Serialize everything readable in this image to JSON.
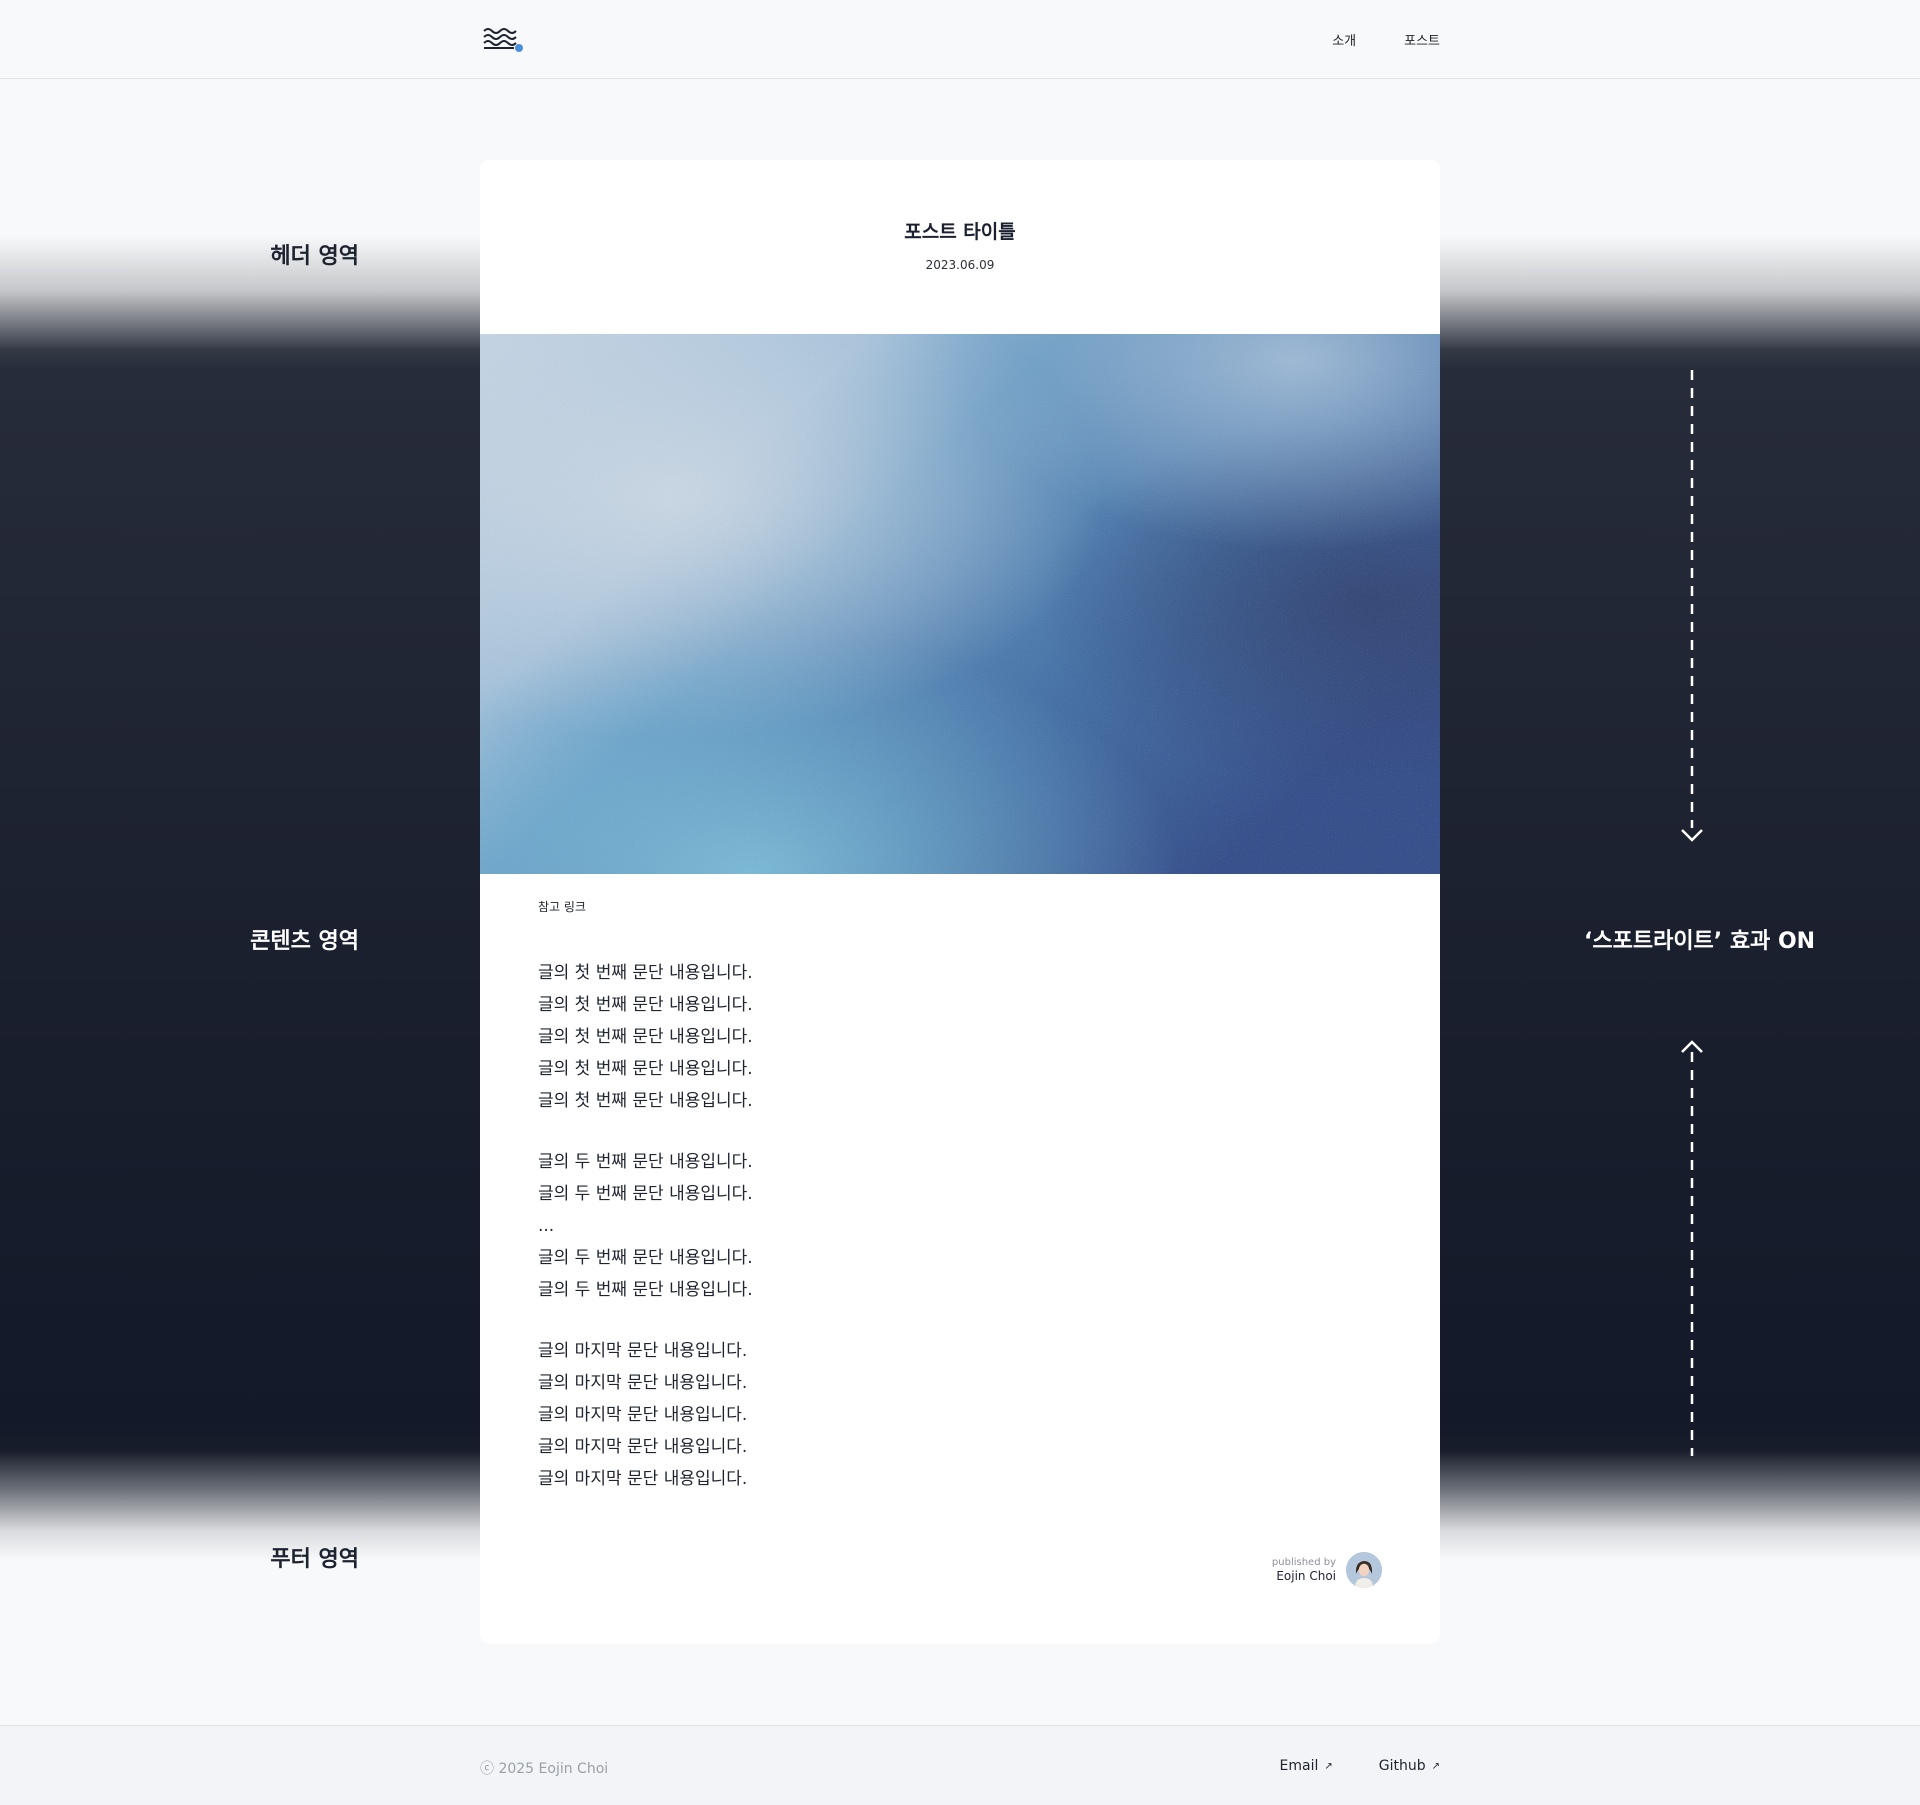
{
  "nav": {
    "items": [
      {
        "label": "소개"
      },
      {
        "label": "포스트"
      }
    ]
  },
  "annotations": {
    "header": "헤더 영역",
    "content": "콘텐츠 영역",
    "footer": "푸터 영역",
    "spotlight": "‘스포트라이트’ 효과 ON"
  },
  "post": {
    "title": "포스트 타이틀",
    "date": "2023.06.09",
    "ref_link": "참고 링크",
    "paragraphs": [
      [
        "글의 첫 번째 문단 내용입니다.",
        "글의 첫 번째 문단 내용입니다.",
        "글의 첫 번째 문단 내용입니다.",
        "글의 첫 번째 문단 내용입니다.",
        "글의 첫 번째 문단 내용입니다."
      ],
      [
        "글의 두 번째 문단 내용입니다.",
        "글의 두 번째 문단 내용입니다.",
        "...",
        "글의 두 번째 문단 내용입니다.",
        "글의 두 번째 문단 내용입니다."
      ],
      [
        "글의 마지막 문단 내용입니다.",
        "글의 마지막 문단 내용입니다.",
        "글의 마지막 문단 내용입니다.",
        "글의 마지막 문단 내용입니다.",
        "글의 마지막 문단 내용입니다."
      ]
    ],
    "published_by": "published by",
    "author": "Eojin Choi"
  },
  "footer": {
    "copyright": "ⓒ 2025 Eojin Choi",
    "links": [
      {
        "label": "Email",
        "icon": "↗"
      },
      {
        "label": "Github",
        "icon": "↗"
      }
    ]
  },
  "icons": {
    "logo": "waves-logo-icon",
    "arrow_down": "arrow-down-icon",
    "arrow_up": "arrow-up-icon",
    "external": "external-link-icon"
  },
  "colors": {
    "page_bg": "#f8f9fb",
    "spotlight_dark": "#131929",
    "card_bg": "#ffffff",
    "accent_blue": "#4a90d9"
  }
}
